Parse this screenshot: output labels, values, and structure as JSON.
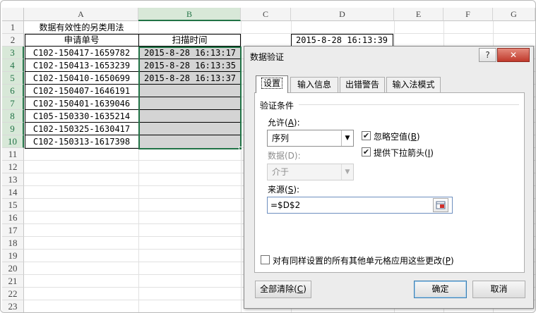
{
  "sheet": {
    "columns": [
      "A",
      "B",
      "C",
      "D",
      "E",
      "F",
      "G"
    ],
    "rows": [
      "1",
      "2",
      "3",
      "4",
      "5",
      "6",
      "7",
      "8",
      "9",
      "10",
      "11",
      "12",
      "13",
      "14",
      "15",
      "16",
      "17",
      "18",
      "19",
      "20",
      "21",
      "22",
      "23"
    ],
    "a1": "数据有效性的另类用法",
    "header_a": "申请单号",
    "header_b": "扫描时间",
    "d2": "2015-8-28 16:13:39",
    "orders": [
      "C102-150417-1659782",
      "C102-150413-1653239",
      "C102-150410-1650699",
      "C102-150407-1646191",
      "C102-150401-1639046",
      "C105-150330-1635214",
      "C102-150325-1630417",
      "C102-150313-1617398"
    ],
    "scan_times": [
      "2015-8-28 16:13:17",
      "2015-8-28 16:13:35",
      "2015-8-28 16:13:37",
      "",
      "",
      "",
      "",
      ""
    ]
  },
  "dialog": {
    "title": "数据验证",
    "help": "?",
    "close": "✕",
    "tabs": [
      "设置",
      "输入信息",
      "出错警告",
      "输入法模式"
    ],
    "section": "验证条件",
    "allow_label": "允许(",
    "allow_key": "A",
    "allow_tail": "):",
    "allow_value": "序列",
    "ignore_blank_label": "忽略空值(",
    "ignore_blank_key": "B",
    "ignore_blank_tail": ")",
    "ignore_blank_checked": true,
    "dropdown_label": "提供下拉箭头(",
    "dropdown_key": "I",
    "dropdown_tail": ")",
    "dropdown_checked": true,
    "data_label": "数据(D):",
    "data_value": "介于",
    "source_label": "来源(",
    "source_key": "S",
    "source_tail": "):",
    "source_value": "=$D$2",
    "apply_all_label": "对有同样设置的所有其他单元格应用这些更改(",
    "apply_all_key": "P",
    "apply_all_tail": ")",
    "apply_all_checked": false,
    "clear_label": "全部清除(",
    "clear_key": "C",
    "clear_tail": ")",
    "ok": "确定",
    "cancel": "取消"
  },
  "colors": {
    "accent_green": "#217346",
    "selected_gray": "#d4d4d4",
    "close_red": "#c0392b"
  }
}
